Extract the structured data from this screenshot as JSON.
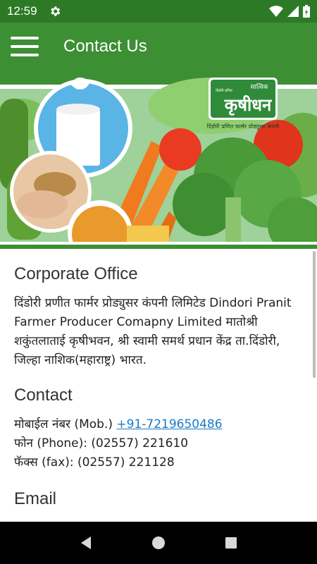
{
  "status_bar": {
    "time": "12:59"
  },
  "app_bar": {
    "title": "Contact Us"
  },
  "banner": {
    "logo_brand": "कृषीधन",
    "logo_small": "सात्विक",
    "logo_side": "दिंडोरी प्रणित",
    "logo_caption": "दिंडोरी प्रणित फार्मर प्रोड्युसर कंपनी"
  },
  "corporate": {
    "heading": "Corporate Office",
    "address": "दिंडोरी प्रणीत फार्मर प्रोड्युसर कंपनी लिमिटेड Dindori Pranit Farmer Producer Comapny Limited मातोश्री शकुंतलाताई कृषीभवन, श्री स्वामी समर्थ प्रधान केंद्र ता.दिंडोरी, जिल्हा नाशिक(महाराष्ट्र) भारत."
  },
  "contact": {
    "heading": "Contact",
    "mobile_label": "मोबाईल नंबर (Mob.) ",
    "mobile_value": "+91-7219650486",
    "phone_line": "फोन (Phone): (02557) 221610",
    "fax_line": "फॅक्स (fax): (02557) 221128"
  },
  "email": {
    "heading": "Email"
  },
  "colors": {
    "status_bar": "#2d7a26",
    "app_bar": "#3d8f34",
    "link": "#1a7ac7"
  }
}
